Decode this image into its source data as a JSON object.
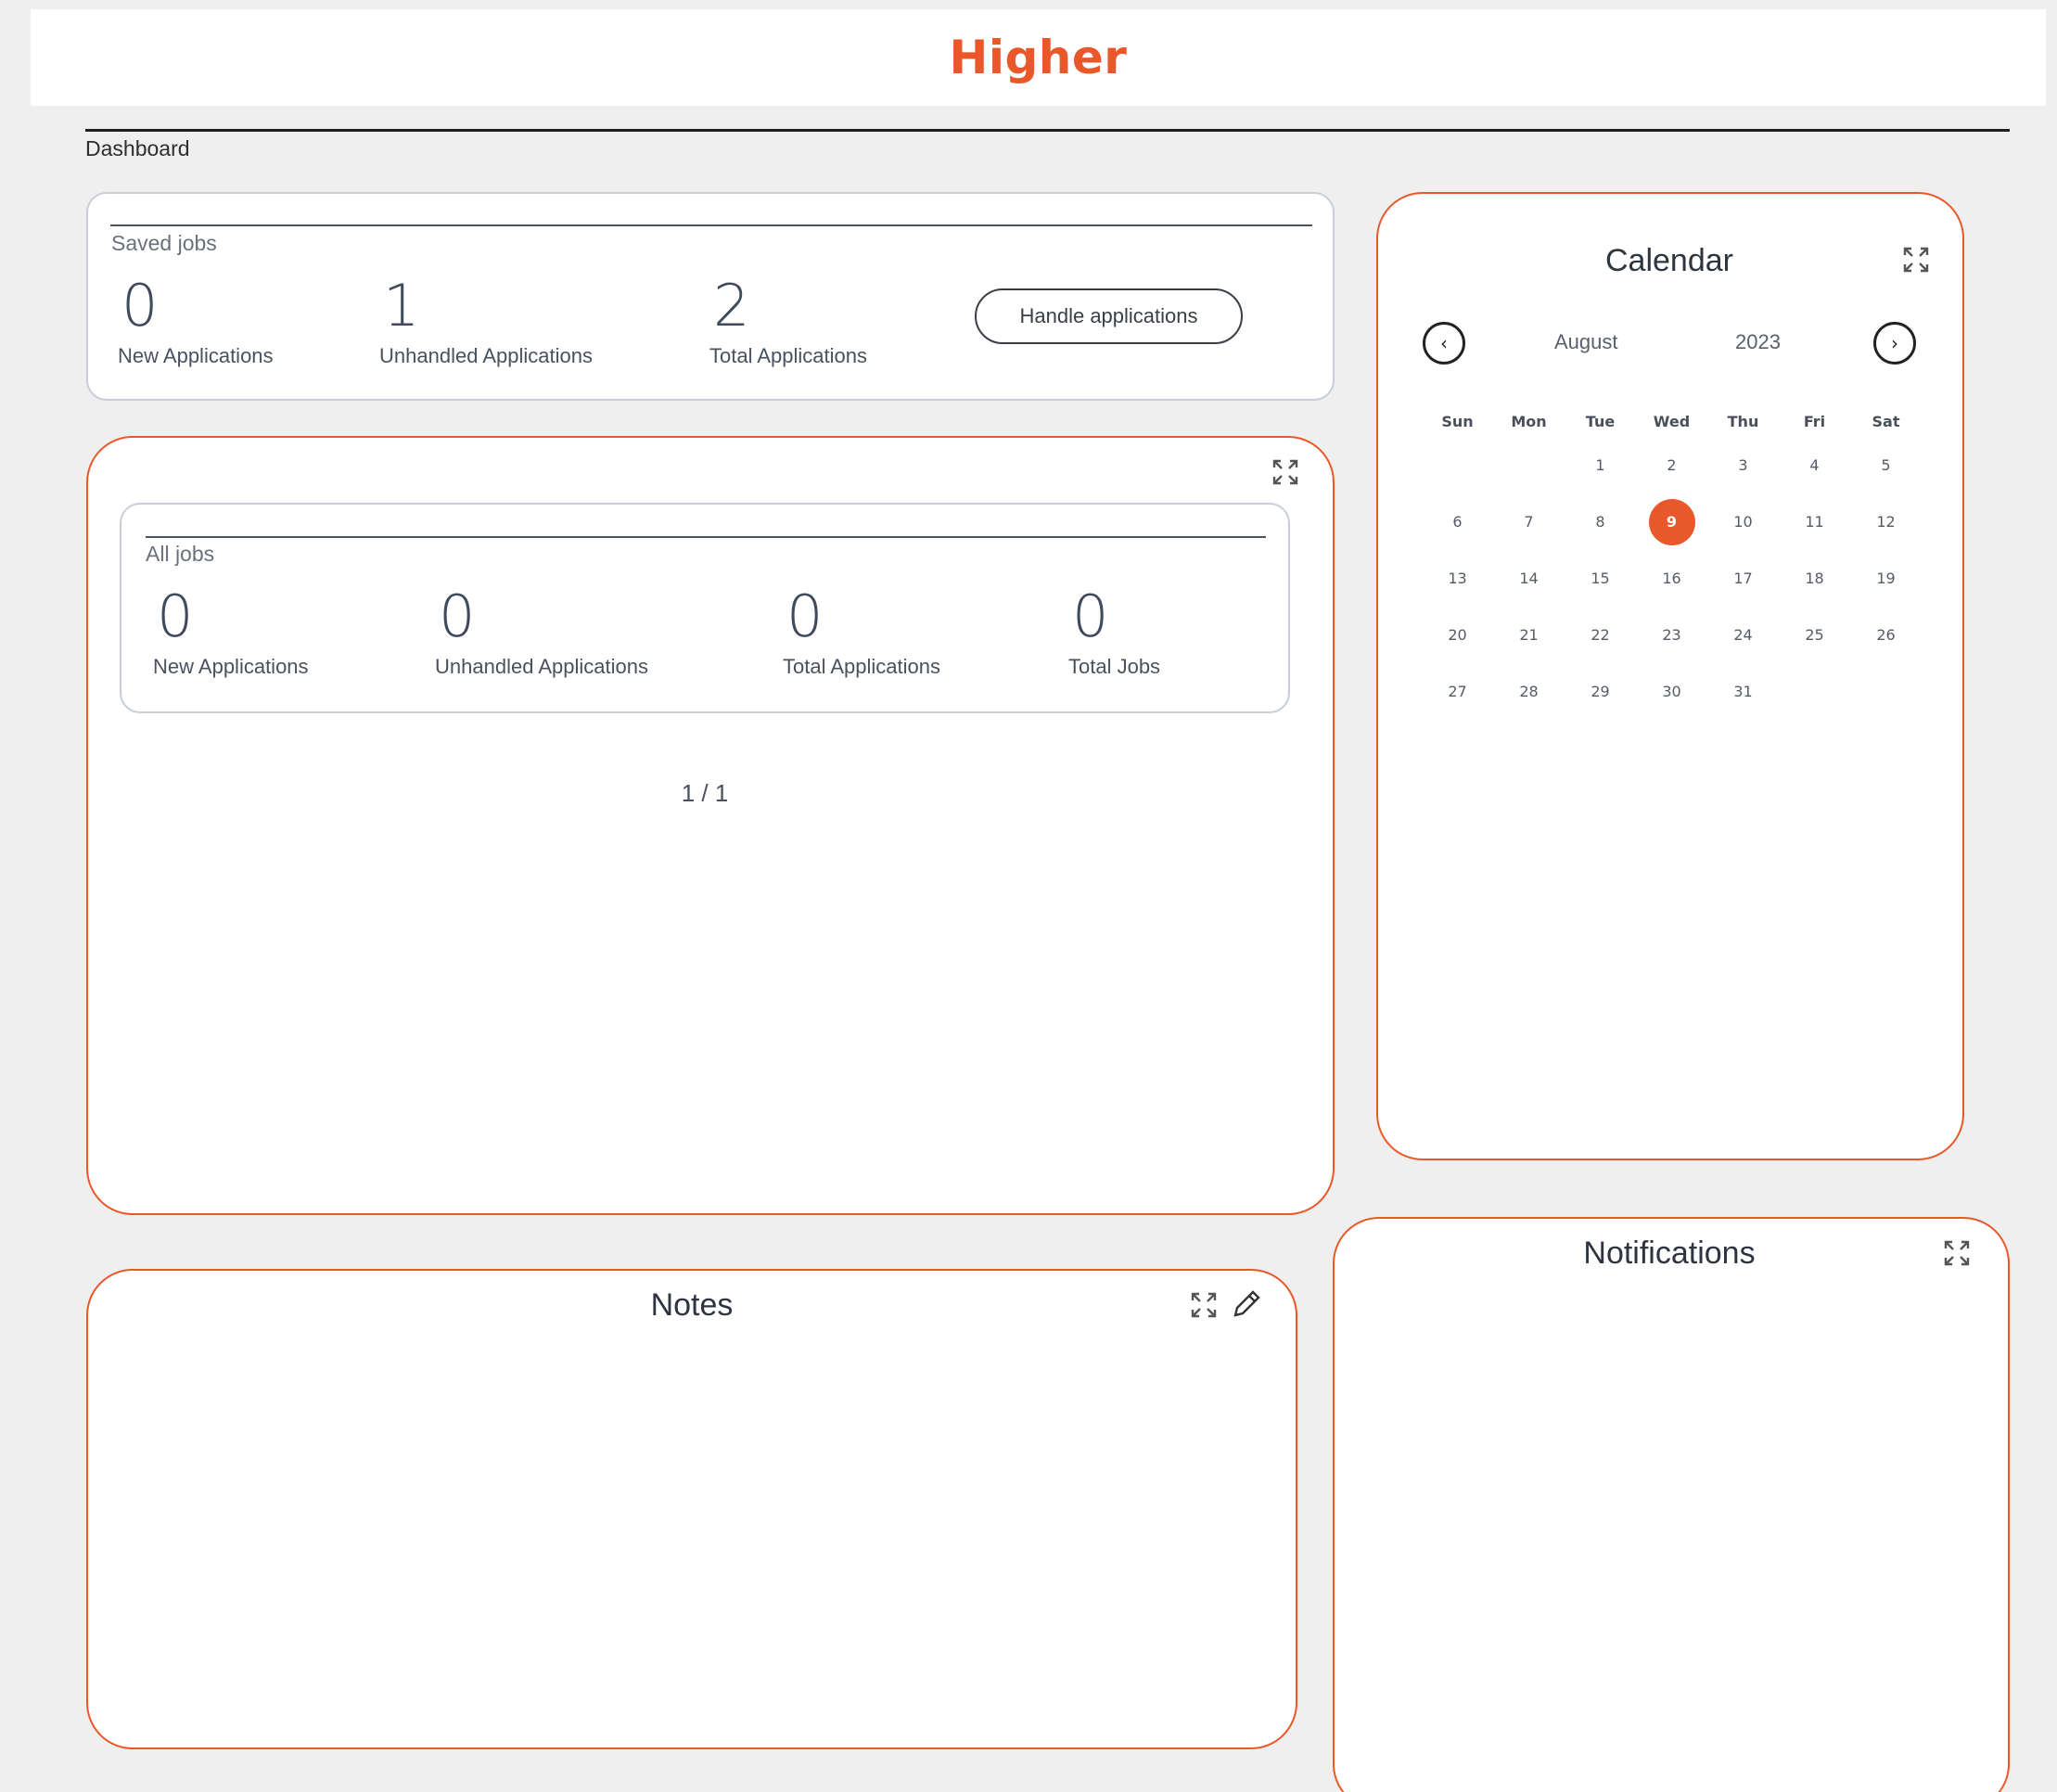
{
  "header": {
    "logo": "Higher"
  },
  "breadcrumb": "Dashboard",
  "saved_jobs": {
    "title": "Saved jobs",
    "stats": [
      {
        "value": "0",
        "label": "New Applications"
      },
      {
        "value": "1",
        "label": "Unhandled Applications"
      },
      {
        "value": "2",
        "label": "Total Applications"
      }
    ],
    "button": "Handle applications"
  },
  "all_jobs": {
    "title": "All jobs",
    "stats": [
      {
        "value": "0",
        "label": "New Applications"
      },
      {
        "value": "0",
        "label": "Unhandled Applications"
      },
      {
        "value": "0",
        "label": "Total Applications"
      },
      {
        "value": "0",
        "label": "Total Jobs"
      }
    ],
    "pager": "1 / 1"
  },
  "calendar": {
    "title": "Calendar",
    "month": "August",
    "year": "2023",
    "weekdays": [
      "Sun",
      "Mon",
      "Tue",
      "Wed",
      "Thu",
      "Fri",
      "Sat"
    ],
    "weeks": [
      [
        "",
        "",
        "1",
        "2",
        "3",
        "4",
        "5"
      ],
      [
        "6",
        "7",
        "8",
        "9",
        "10",
        "11",
        "12"
      ],
      [
        "13",
        "14",
        "15",
        "16",
        "17",
        "18",
        "19"
      ],
      [
        "20",
        "21",
        "22",
        "23",
        "24",
        "25",
        "26"
      ],
      [
        "27",
        "28",
        "29",
        "30",
        "31",
        "",
        ""
      ]
    ],
    "selected_day": "9"
  },
  "notes": {
    "title": "Notes"
  },
  "notifications": {
    "title": "Notifications"
  },
  "colors": {
    "accent": "#e8582a",
    "background": "#efefef",
    "text": "#3a3f47"
  },
  "icons": {
    "expand": "expand-icon",
    "edit": "pencil-icon",
    "prev": "chevron-left-icon",
    "next": "chevron-right-icon"
  }
}
